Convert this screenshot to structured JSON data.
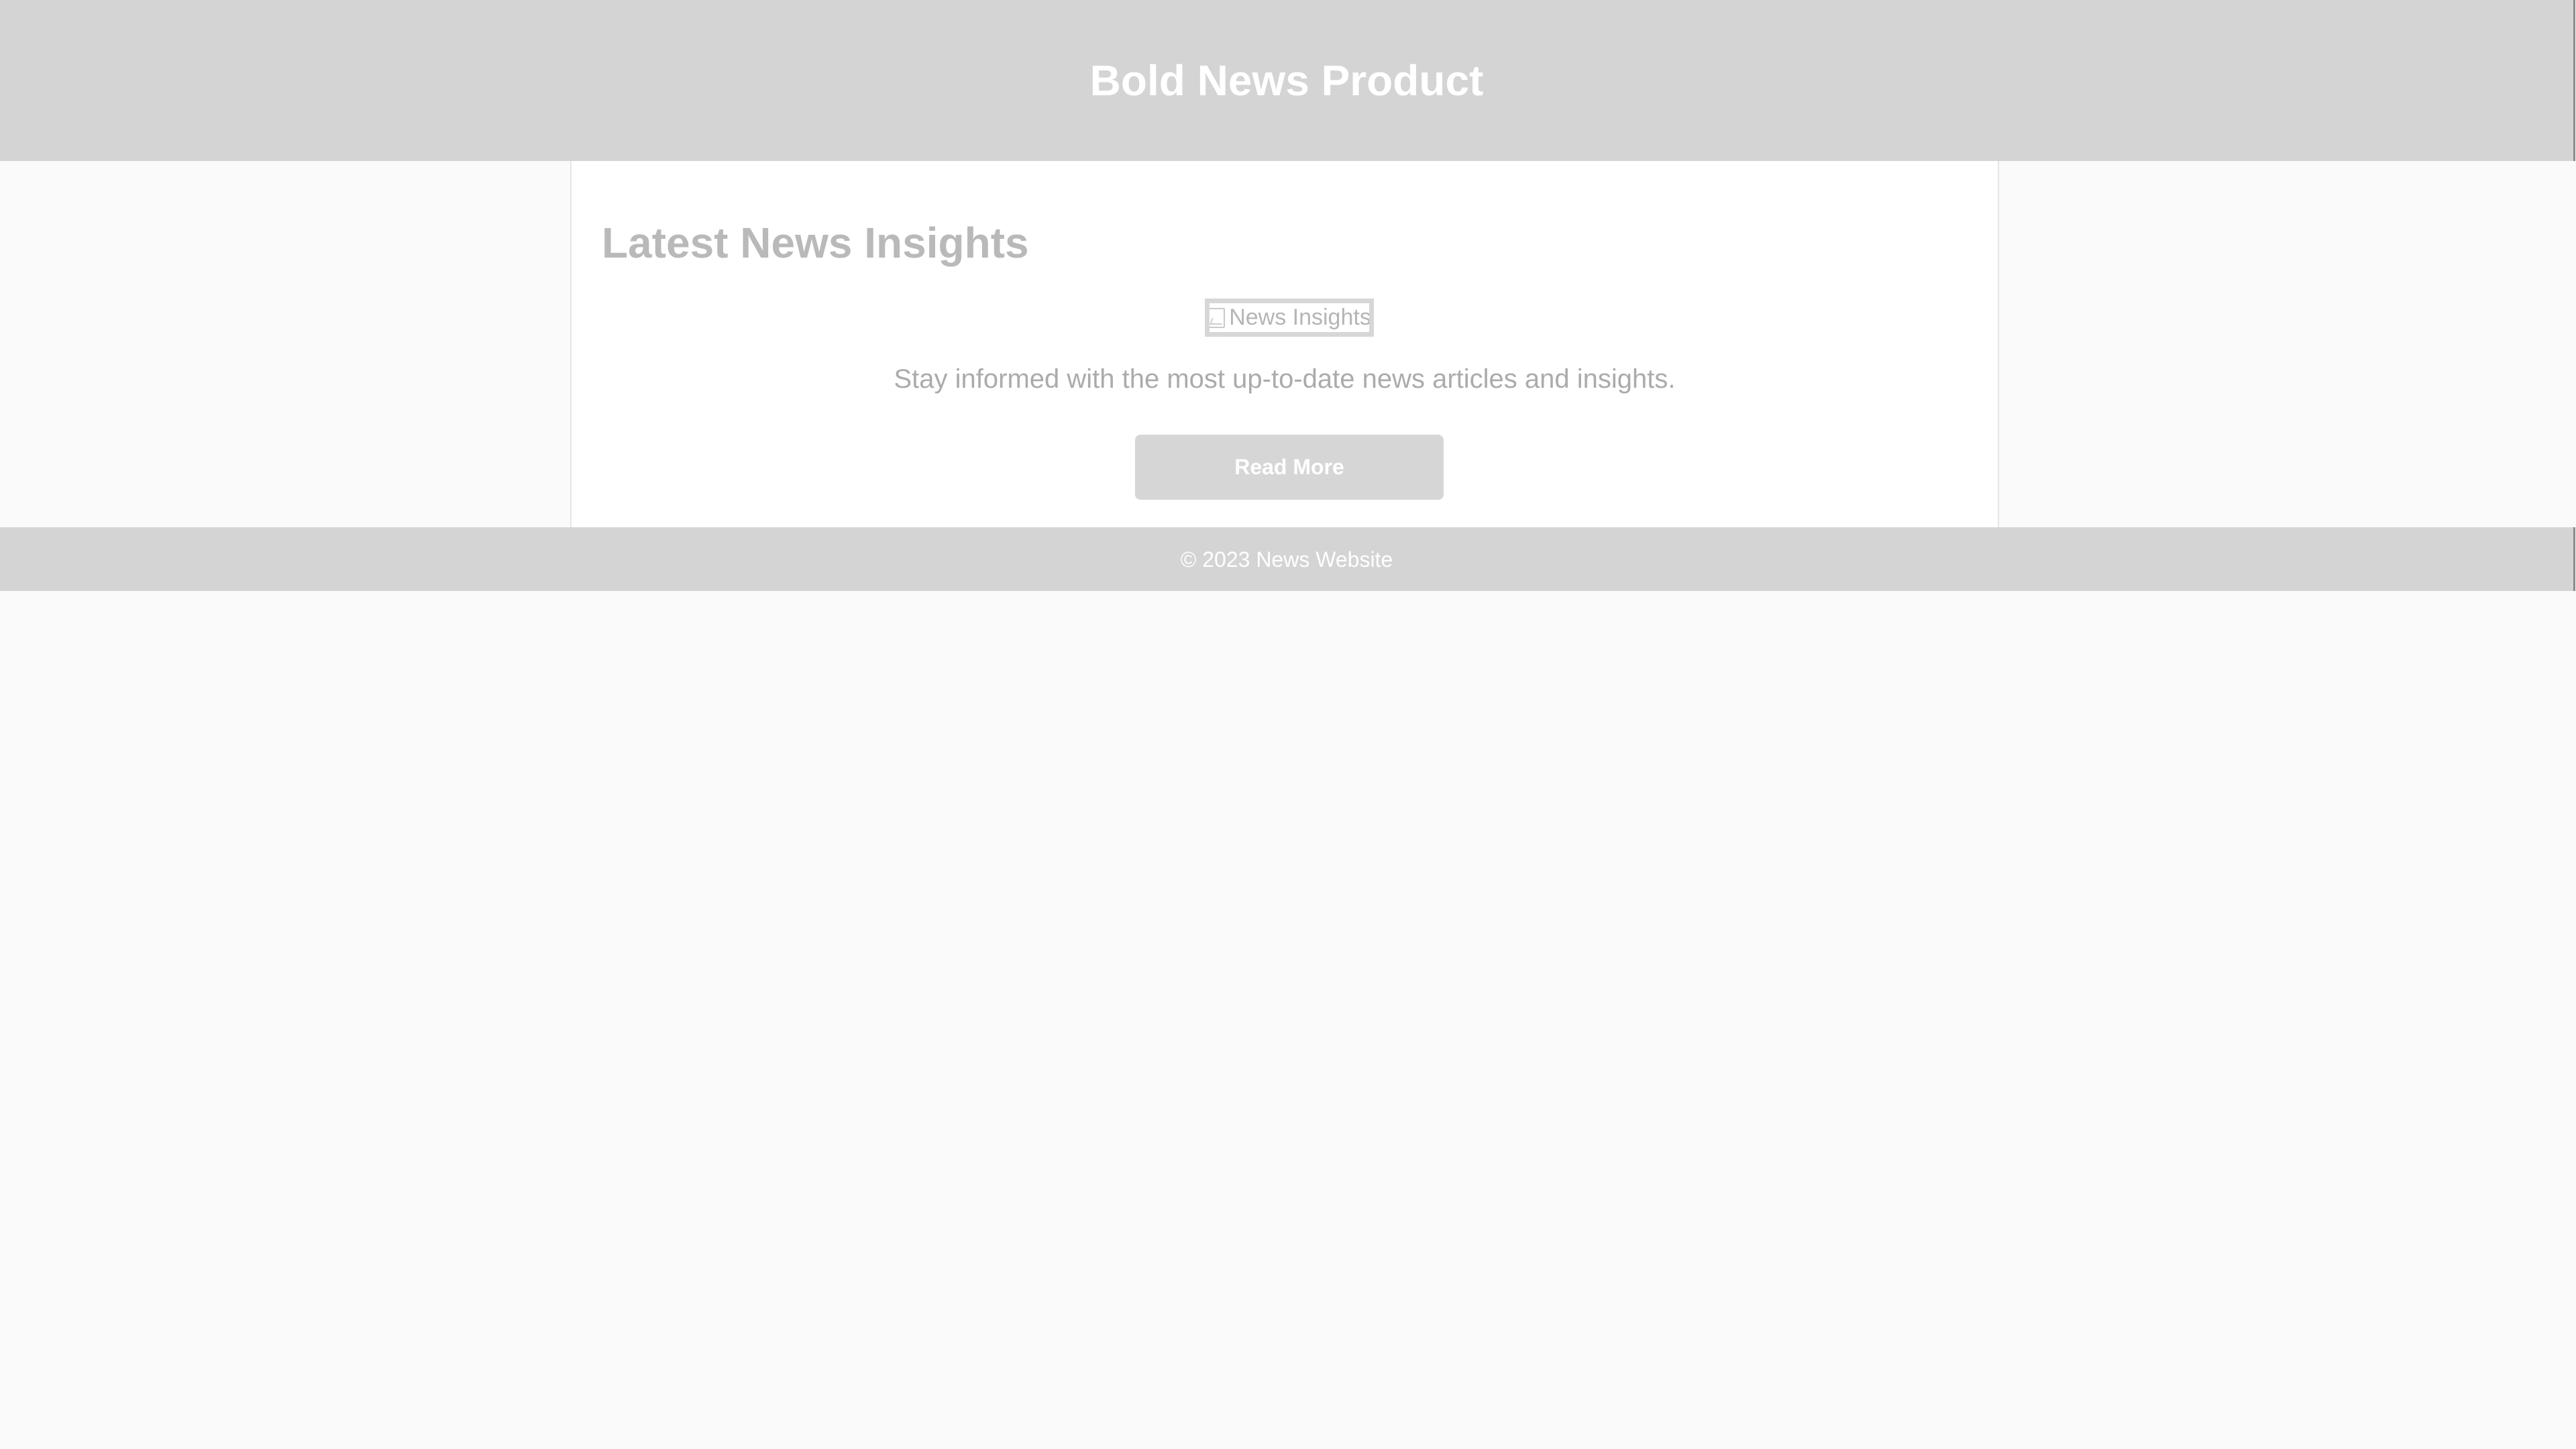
{
  "header": {
    "title": "Bold News Product"
  },
  "main": {
    "heading": "Latest News Insights",
    "image": {
      "alt": "News Insights",
      "icon": "broken-image-icon"
    },
    "description": "Stay informed with the most up-to-date news articles and insights.",
    "button_label": "Read More"
  },
  "footer": {
    "text": "© 2023 News Website"
  },
  "colors": {
    "page_background": "#fafafa",
    "header_background": "#d4d4d4",
    "card_background": "#ffffff",
    "heading_text": "#b9b9b9",
    "body_text": "#ababab",
    "button_background": "#d6d6d6",
    "button_text": "#ffffff"
  }
}
